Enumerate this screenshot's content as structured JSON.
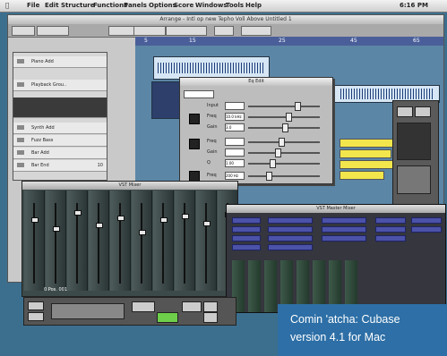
{
  "menubar": {
    "apple": "",
    "items": [
      "File",
      "Edit",
      "Structure",
      "Functions",
      "Panels",
      "Options",
      "Score",
      "Windows",
      "Tools",
      "Help"
    ],
    "clock": "6:16 PM"
  },
  "arrange": {
    "title": "Arrange - Intl op new Tepho Voll Above Untitled 1",
    "ruler_marks": [
      "5",
      "15",
      "25",
      "45",
      "65"
    ]
  },
  "tracks": {
    "items": [
      {
        "label": "Piano Add",
        "num": ""
      },
      {
        "label": "Playback Grou..",
        "num": ""
      },
      {
        "label": "",
        "num": ""
      },
      {
        "label": "Synth Add",
        "num": ""
      },
      {
        "label": "Fuzz Bass",
        "num": ""
      },
      {
        "label": "Bar Add",
        "num": ""
      },
      {
        "label": "Bar End",
        "num": "10"
      }
    ]
  },
  "eq": {
    "title": "Eq Edit",
    "rows": [
      {
        "label": "Input",
        "value": ""
      },
      {
        "label": "Freq",
        "value": "10.0 kHz"
      },
      {
        "label": "Gain",
        "value": "3.0"
      },
      {
        "label": "Freq",
        "value": ""
      },
      {
        "label": "Gain",
        "value": ""
      },
      {
        "label": "Q",
        "value": "1.00"
      },
      {
        "label": "Freq",
        "value": "200 Hz"
      }
    ]
  },
  "mixer": {
    "title": "VST Mixer"
  },
  "master": {
    "title": "VST Master Mixer"
  },
  "transport": {
    "position": "0 Pos. 001"
  },
  "caption": {
    "line1": "Comin 'atcha: Cubase",
    "line2": "version 4.1 for Mac"
  },
  "colors": {
    "caption_bg": "#2d6fa6",
    "track_area": "#5c86a6",
    "ruler": "#4a5f9a",
    "clip_audio": "#d6e6f4"
  }
}
